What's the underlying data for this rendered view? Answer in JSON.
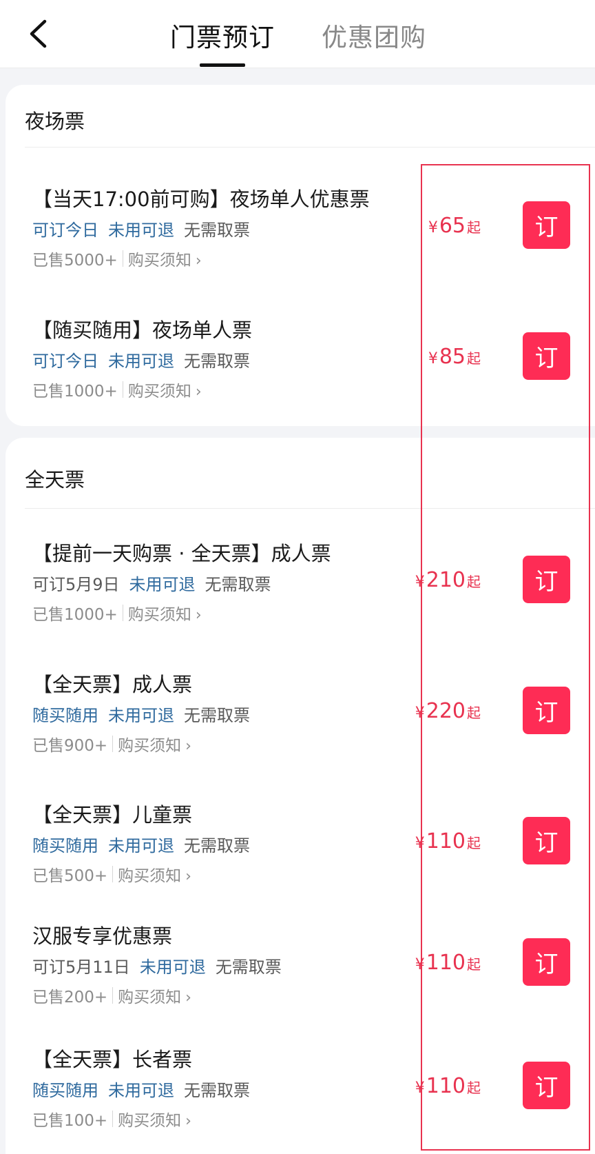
{
  "header": {
    "tabs": [
      {
        "label": "门票预订",
        "active": true
      },
      {
        "label": "优惠团购",
        "active": false
      }
    ]
  },
  "sections": [
    {
      "title": "夜场票",
      "tickets": [
        {
          "name": "【当天17:00前可购】夜场单人优惠票",
          "tags": [
            {
              "text": "可订今日",
              "style": "blue"
            },
            {
              "text": "未用可退",
              "style": "blue"
            },
            {
              "text": "无需取票",
              "style": "gray"
            }
          ],
          "sold": "已售5000+",
          "notice": "购买须知",
          "currency": "¥",
          "price": "65",
          "suffix": "起",
          "button": "订"
        },
        {
          "name": "【随买随用】夜场单人票",
          "tags": [
            {
              "text": "可订今日",
              "style": "blue"
            },
            {
              "text": "未用可退",
              "style": "blue"
            },
            {
              "text": "无需取票",
              "style": "gray"
            }
          ],
          "sold": "已售1000+",
          "notice": "购买须知",
          "currency": "¥",
          "price": "85",
          "suffix": "起",
          "button": "订"
        }
      ]
    },
    {
      "title": "全天票",
      "tickets": [
        {
          "name": "【提前一天购票 · 全天票】成人票",
          "tags": [
            {
              "text": "可订5月9日",
              "style": "gray"
            },
            {
              "text": "未用可退",
              "style": "blue"
            },
            {
              "text": "无需取票",
              "style": "gray"
            }
          ],
          "sold": "已售1000+",
          "notice": "购买须知",
          "currency": "¥",
          "price": "210",
          "suffix": "起",
          "button": "订"
        },
        {
          "name": "【全天票】成人票",
          "tags": [
            {
              "text": "随买随用",
              "style": "blue"
            },
            {
              "text": "未用可退",
              "style": "blue"
            },
            {
              "text": "无需取票",
              "style": "gray"
            }
          ],
          "sold": "已售900+",
          "notice": "购买须知",
          "currency": "¥",
          "price": "220",
          "suffix": "起",
          "button": "订"
        },
        {
          "name": "【全天票】儿童票",
          "tags": [
            {
              "text": "随买随用",
              "style": "blue"
            },
            {
              "text": "未用可退",
              "style": "blue"
            },
            {
              "text": "无需取票",
              "style": "gray"
            }
          ],
          "sold": "已售500+",
          "notice": "购买须知",
          "currency": "¥",
          "price": "110",
          "suffix": "起",
          "button": "订"
        },
        {
          "name": "汉服专享优惠票",
          "tags": [
            {
              "text": "可订5月11日",
              "style": "gray"
            },
            {
              "text": "未用可退",
              "style": "blue"
            },
            {
              "text": "无需取票",
              "style": "gray"
            }
          ],
          "sold": "已售200+",
          "notice": "购买须知",
          "currency": "¥",
          "price": "110",
          "suffix": "起",
          "button": "订"
        },
        {
          "name": "【全天票】长者票",
          "tags": [
            {
              "text": "随买随用",
              "style": "blue"
            },
            {
              "text": "未用可退",
              "style": "blue"
            },
            {
              "text": "无需取票",
              "style": "gray"
            }
          ],
          "sold": "已售100+",
          "notice": "购买须知",
          "currency": "¥",
          "price": "110",
          "suffix": "起",
          "button": "订"
        }
      ]
    }
  ],
  "colors": {
    "accent": "#fe2c55",
    "price": "#e8324f",
    "tag_blue": "#2f6a9e",
    "highlight": "#e8324f"
  },
  "icons": {
    "back": "chevron-left-icon",
    "notice": "chevron-right-icon"
  }
}
